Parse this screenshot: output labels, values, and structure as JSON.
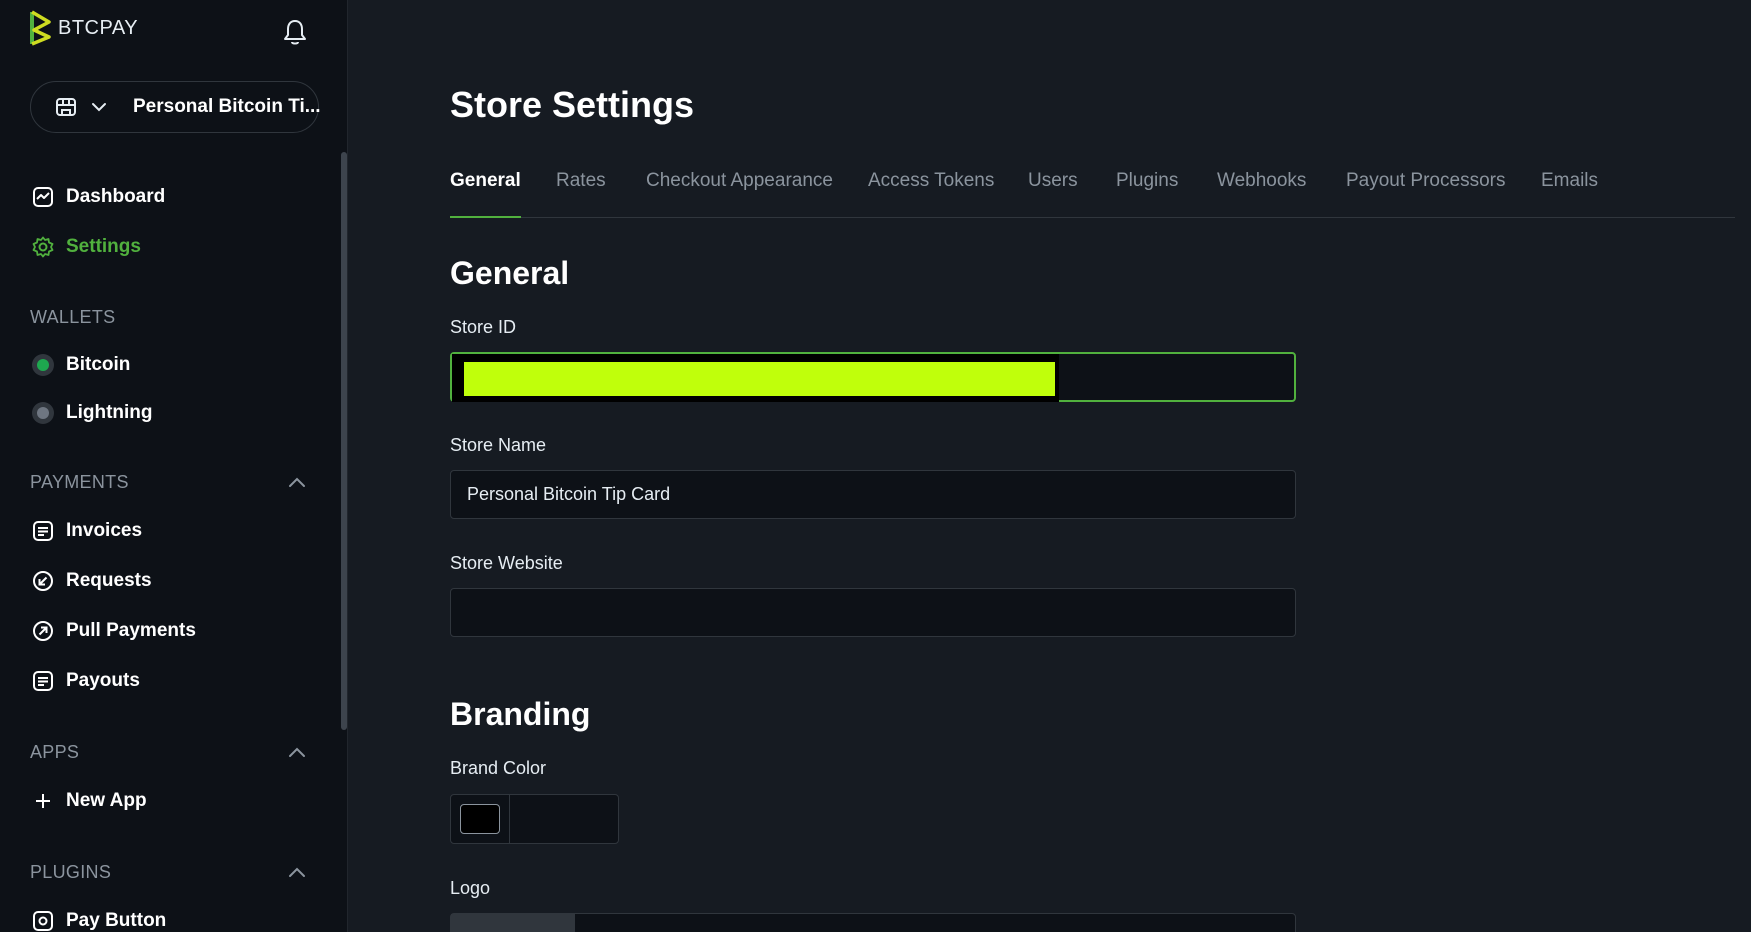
{
  "sidebar": {
    "logo_text": "BTCPAY",
    "store_selector": {
      "label": "Personal Bitcoin Ti..."
    },
    "nav": [
      {
        "label": "Dashboard",
        "icon": "dashboard-icon",
        "active": false
      },
      {
        "label": "Settings",
        "icon": "gear-icon",
        "active": true
      }
    ],
    "wallets": {
      "title": "WALLETS",
      "items": [
        {
          "label": "Bitcoin",
          "status": "enabled",
          "status_color": "#1ea84f"
        },
        {
          "label": "Lightning",
          "status": "disabled",
          "status_color": "#5a6069"
        }
      ]
    },
    "payments": {
      "title": "PAYMENTS",
      "items": [
        {
          "label": "Invoices",
          "icon": "invoice-icon"
        },
        {
          "label": "Requests",
          "icon": "request-icon"
        },
        {
          "label": "Pull Payments",
          "icon": "pull-payment-icon"
        },
        {
          "label": "Payouts",
          "icon": "payout-icon"
        }
      ]
    },
    "apps": {
      "title": "APPS",
      "items": [
        {
          "label": "New App",
          "icon": "plus-icon"
        }
      ]
    },
    "plugins": {
      "title": "PLUGINS",
      "items": [
        {
          "label": "Pay Button",
          "icon": "pay-button-icon"
        }
      ]
    }
  },
  "main": {
    "title": "Store Settings",
    "tabs": [
      {
        "label": "General",
        "active": true
      },
      {
        "label": "Rates"
      },
      {
        "label": "Checkout Appearance"
      },
      {
        "label": "Access Tokens"
      },
      {
        "label": "Users"
      },
      {
        "label": "Plugins"
      },
      {
        "label": "Webhooks"
      },
      {
        "label": "Payout Processors"
      },
      {
        "label": "Emails"
      }
    ],
    "general": {
      "heading": "General",
      "store_id_label": "Store ID",
      "store_name_label": "Store Name",
      "store_name_value": "Personal Bitcoin Tip Card",
      "store_website_label": "Store Website",
      "store_website_value": ""
    },
    "branding": {
      "heading": "Branding",
      "brand_color_label": "Brand Color",
      "brand_color_value": "#000000",
      "logo_label": "Logo"
    }
  },
  "colors": {
    "accent": "#51b13e",
    "redaction": "#c0ff0b",
    "background": "#161b22",
    "sidebar": "#0d1117"
  }
}
